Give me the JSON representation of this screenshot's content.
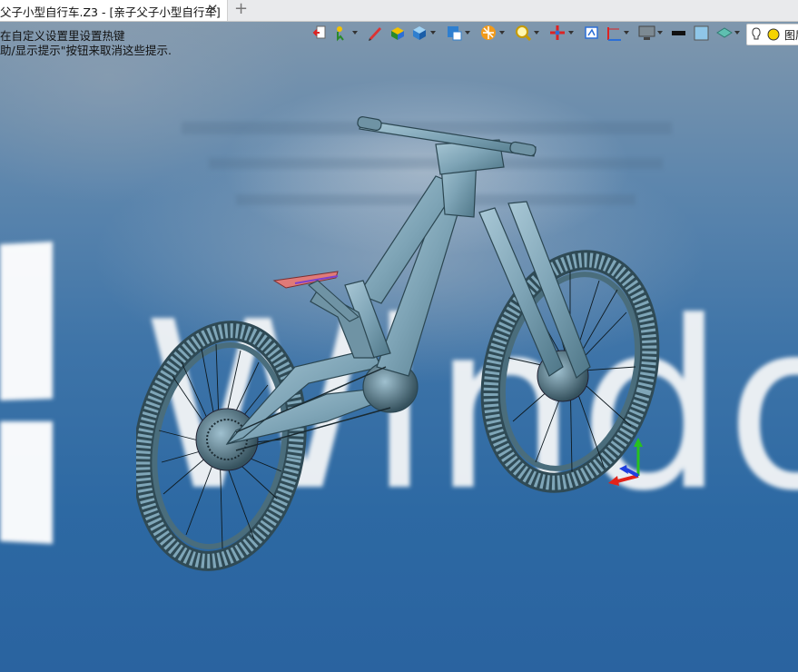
{
  "tab": {
    "title": "父子小型自行车.Z3 - [亲子父子小型自行车]",
    "close_glyph": "✕",
    "new_tab_glyph": "+"
  },
  "hints": {
    "line1": "在自定义设置里设置热键",
    "line2": "助/显示提示\"按钮来取消这些提示."
  },
  "background": {
    "watermark_text": "Windo"
  },
  "toolbar": {
    "icons": [
      "exit-icon",
      "select-filter-icon",
      "pen-icon",
      "shaded-box-icon",
      "cube-view-icon",
      "display-mode-icon",
      "render-icon",
      "zoom-icon",
      "axis-icon",
      "view-orient-icon",
      "datum-plane-icon",
      "monitor-icon",
      "black-bar-icon",
      "background-color-icon",
      "layer-icon",
      "lightbulb-icon"
    ],
    "legend_label": "图层"
  },
  "colors": {
    "frame": "#7fa6b8",
    "frame_dark": "#34515e",
    "saddle": "#e07a78",
    "axis_x": "#e2231a",
    "axis_y": "#27c11f",
    "axis_z": "#1f3fe0"
  }
}
